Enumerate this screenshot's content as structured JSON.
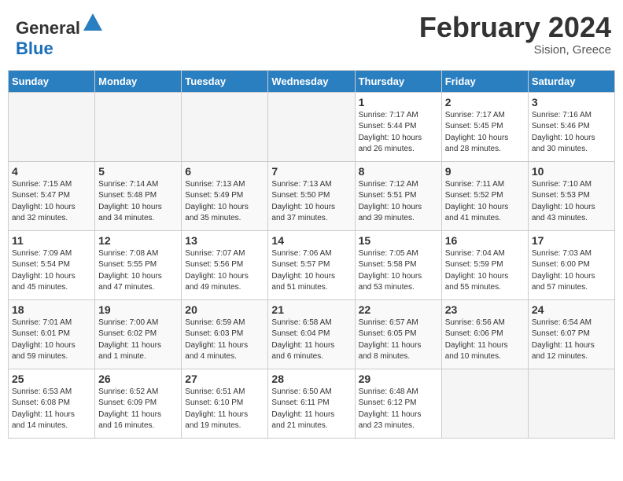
{
  "header": {
    "logo_line1": "General",
    "logo_line2": "Blue",
    "month_year": "February 2024",
    "location": "Sision, Greece"
  },
  "weekdays": [
    "Sunday",
    "Monday",
    "Tuesday",
    "Wednesday",
    "Thursday",
    "Friday",
    "Saturday"
  ],
  "weeks": [
    [
      {
        "day": "",
        "info": ""
      },
      {
        "day": "",
        "info": ""
      },
      {
        "day": "",
        "info": ""
      },
      {
        "day": "",
        "info": ""
      },
      {
        "day": "1",
        "info": "Sunrise: 7:17 AM\nSunset: 5:44 PM\nDaylight: 10 hours\nand 26 minutes."
      },
      {
        "day": "2",
        "info": "Sunrise: 7:17 AM\nSunset: 5:45 PM\nDaylight: 10 hours\nand 28 minutes."
      },
      {
        "day": "3",
        "info": "Sunrise: 7:16 AM\nSunset: 5:46 PM\nDaylight: 10 hours\nand 30 minutes."
      }
    ],
    [
      {
        "day": "4",
        "info": "Sunrise: 7:15 AM\nSunset: 5:47 PM\nDaylight: 10 hours\nand 32 minutes."
      },
      {
        "day": "5",
        "info": "Sunrise: 7:14 AM\nSunset: 5:48 PM\nDaylight: 10 hours\nand 34 minutes."
      },
      {
        "day": "6",
        "info": "Sunrise: 7:13 AM\nSunset: 5:49 PM\nDaylight: 10 hours\nand 35 minutes."
      },
      {
        "day": "7",
        "info": "Sunrise: 7:13 AM\nSunset: 5:50 PM\nDaylight: 10 hours\nand 37 minutes."
      },
      {
        "day": "8",
        "info": "Sunrise: 7:12 AM\nSunset: 5:51 PM\nDaylight: 10 hours\nand 39 minutes."
      },
      {
        "day": "9",
        "info": "Sunrise: 7:11 AM\nSunset: 5:52 PM\nDaylight: 10 hours\nand 41 minutes."
      },
      {
        "day": "10",
        "info": "Sunrise: 7:10 AM\nSunset: 5:53 PM\nDaylight: 10 hours\nand 43 minutes."
      }
    ],
    [
      {
        "day": "11",
        "info": "Sunrise: 7:09 AM\nSunset: 5:54 PM\nDaylight: 10 hours\nand 45 minutes."
      },
      {
        "day": "12",
        "info": "Sunrise: 7:08 AM\nSunset: 5:55 PM\nDaylight: 10 hours\nand 47 minutes."
      },
      {
        "day": "13",
        "info": "Sunrise: 7:07 AM\nSunset: 5:56 PM\nDaylight: 10 hours\nand 49 minutes."
      },
      {
        "day": "14",
        "info": "Sunrise: 7:06 AM\nSunset: 5:57 PM\nDaylight: 10 hours\nand 51 minutes."
      },
      {
        "day": "15",
        "info": "Sunrise: 7:05 AM\nSunset: 5:58 PM\nDaylight: 10 hours\nand 53 minutes."
      },
      {
        "day": "16",
        "info": "Sunrise: 7:04 AM\nSunset: 5:59 PM\nDaylight: 10 hours\nand 55 minutes."
      },
      {
        "day": "17",
        "info": "Sunrise: 7:03 AM\nSunset: 6:00 PM\nDaylight: 10 hours\nand 57 minutes."
      }
    ],
    [
      {
        "day": "18",
        "info": "Sunrise: 7:01 AM\nSunset: 6:01 PM\nDaylight: 10 hours\nand 59 minutes."
      },
      {
        "day": "19",
        "info": "Sunrise: 7:00 AM\nSunset: 6:02 PM\nDaylight: 11 hours\nand 1 minute."
      },
      {
        "day": "20",
        "info": "Sunrise: 6:59 AM\nSunset: 6:03 PM\nDaylight: 11 hours\nand 4 minutes."
      },
      {
        "day": "21",
        "info": "Sunrise: 6:58 AM\nSunset: 6:04 PM\nDaylight: 11 hours\nand 6 minutes."
      },
      {
        "day": "22",
        "info": "Sunrise: 6:57 AM\nSunset: 6:05 PM\nDaylight: 11 hours\nand 8 minutes."
      },
      {
        "day": "23",
        "info": "Sunrise: 6:56 AM\nSunset: 6:06 PM\nDaylight: 11 hours\nand 10 minutes."
      },
      {
        "day": "24",
        "info": "Sunrise: 6:54 AM\nSunset: 6:07 PM\nDaylight: 11 hours\nand 12 minutes."
      }
    ],
    [
      {
        "day": "25",
        "info": "Sunrise: 6:53 AM\nSunset: 6:08 PM\nDaylight: 11 hours\nand 14 minutes."
      },
      {
        "day": "26",
        "info": "Sunrise: 6:52 AM\nSunset: 6:09 PM\nDaylight: 11 hours\nand 16 minutes."
      },
      {
        "day": "27",
        "info": "Sunrise: 6:51 AM\nSunset: 6:10 PM\nDaylight: 11 hours\nand 19 minutes."
      },
      {
        "day": "28",
        "info": "Sunrise: 6:50 AM\nSunset: 6:11 PM\nDaylight: 11 hours\nand 21 minutes."
      },
      {
        "day": "29",
        "info": "Sunrise: 6:48 AM\nSunset: 6:12 PM\nDaylight: 11 hours\nand 23 minutes."
      },
      {
        "day": "",
        "info": ""
      },
      {
        "day": "",
        "info": ""
      }
    ]
  ]
}
